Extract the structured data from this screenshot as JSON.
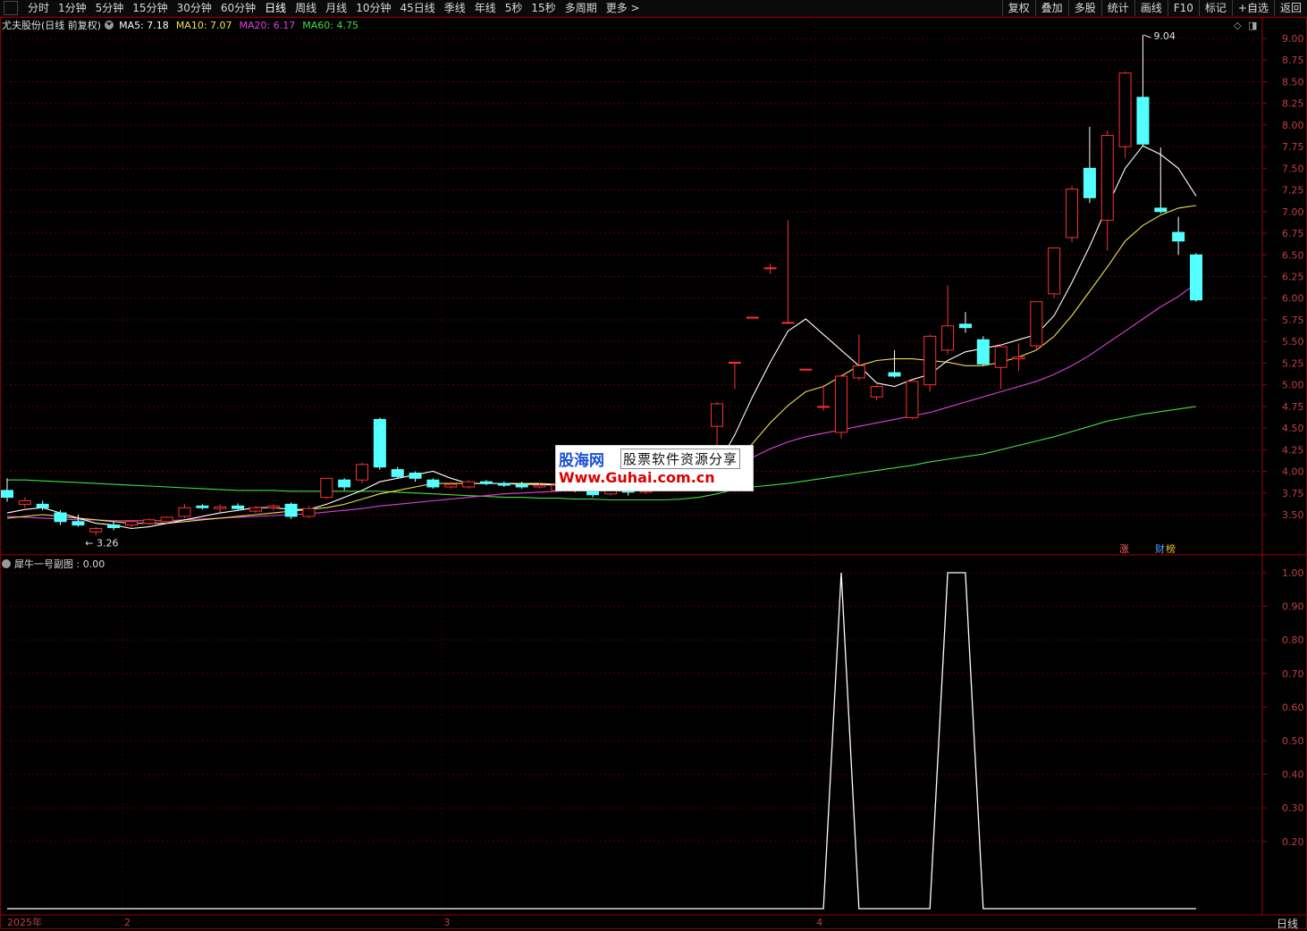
{
  "toolbar": {
    "tabs": [
      "分时",
      "1分钟",
      "5分钟",
      "15分钟",
      "30分钟",
      "60分钟",
      "日线",
      "周线",
      "月线",
      "10分钟",
      "45日线",
      "季线",
      "年线",
      "5秒",
      "15秒",
      "多周期",
      "更多 >"
    ],
    "active_tab": "日线",
    "right_buttons": [
      "复权",
      "叠加",
      "多股",
      "统计",
      "画线",
      "F10",
      "标记",
      "+自选",
      "返回"
    ]
  },
  "info": {
    "stock": "尤夫股份(日线 前复权)",
    "ma5": "MA5: 7.18",
    "ma10": "MA10: 7.07",
    "ma20": "MA20: 6.17",
    "ma60": "MA60: 4.75",
    "colors": {
      "ma5": "#ffffff",
      "ma10": "#f0e050",
      "ma20": "#e040e0",
      "ma60": "#40e040"
    }
  },
  "price_axis": [
    "9.00",
    "8.75",
    "8.50",
    "8.25",
    "8.00",
    "7.75",
    "7.50",
    "7.25",
    "7.00",
    "6.75",
    "6.50",
    "6.25",
    "6.00",
    "5.75",
    "5.50",
    "5.25",
    "5.00",
    "4.75",
    "4.50",
    "4.25",
    "4.00",
    "3.75",
    "3.50"
  ],
  "price_range": [
    3.2,
    9.1
  ],
  "annotations": {
    "high": "9.04",
    "low": "3.26"
  },
  "candles": [
    {
      "o": 3.78,
      "h": 3.92,
      "l": 3.65,
      "c": 3.7
    },
    {
      "o": 3.62,
      "h": 3.7,
      "l": 3.58,
      "c": 3.66
    },
    {
      "o": 3.62,
      "h": 3.66,
      "l": 3.55,
      "c": 3.58
    },
    {
      "o": 3.52,
      "h": 3.55,
      "l": 3.38,
      "c": 3.42
    },
    {
      "o": 3.42,
      "h": 3.5,
      "l": 3.36,
      "c": 3.38
    },
    {
      "o": 3.3,
      "h": 3.36,
      "l": 3.26,
      "c": 3.34
    },
    {
      "o": 3.38,
      "h": 3.42,
      "l": 3.32,
      "c": 3.35
    },
    {
      "o": 3.38,
      "h": 3.44,
      "l": 3.35,
      "c": 3.42
    },
    {
      "o": 3.4,
      "h": 3.46,
      "l": 3.38,
      "c": 3.44
    },
    {
      "o": 3.42,
      "h": 3.48,
      "l": 3.4,
      "c": 3.47
    },
    {
      "o": 3.48,
      "h": 3.62,
      "l": 3.46,
      "c": 3.58
    },
    {
      "o": 3.6,
      "h": 3.62,
      "l": 3.56,
      "c": 3.58
    },
    {
      "o": 3.57,
      "h": 3.62,
      "l": 3.53,
      "c": 3.59
    },
    {
      "o": 3.6,
      "h": 3.63,
      "l": 3.56,
      "c": 3.57
    },
    {
      "o": 3.54,
      "h": 3.6,
      "l": 3.52,
      "c": 3.58
    },
    {
      "o": 3.58,
      "h": 3.62,
      "l": 3.55,
      "c": 3.6
    },
    {
      "o": 3.62,
      "h": 3.64,
      "l": 3.45,
      "c": 3.48
    },
    {
      "o": 3.48,
      "h": 3.6,
      "l": 3.46,
      "c": 3.57
    },
    {
      "o": 3.7,
      "h": 3.92,
      "l": 3.68,
      "c": 3.92
    },
    {
      "o": 3.9,
      "h": 3.92,
      "l": 3.78,
      "c": 3.82
    },
    {
      "o": 3.9,
      "h": 4.1,
      "l": 3.86,
      "c": 4.08
    },
    {
      "o": 4.6,
      "h": 4.62,
      "l": 4.02,
      "c": 4.05
    },
    {
      "o": 4.02,
      "h": 4.05,
      "l": 3.92,
      "c": 3.94
    },
    {
      "o": 3.98,
      "h": 4.0,
      "l": 3.88,
      "c": 3.92
    },
    {
      "o": 3.9,
      "h": 3.92,
      "l": 3.8,
      "c": 3.82
    },
    {
      "o": 3.82,
      "h": 3.88,
      "l": 3.8,
      "c": 3.85
    },
    {
      "o": 3.82,
      "h": 3.9,
      "l": 3.8,
      "c": 3.88
    },
    {
      "o": 3.88,
      "h": 3.9,
      "l": 3.84,
      "c": 3.86
    },
    {
      "o": 3.86,
      "h": 3.88,
      "l": 3.82,
      "c": 3.84
    },
    {
      "o": 3.85,
      "h": 3.88,
      "l": 3.8,
      "c": 3.82
    },
    {
      "o": 3.82,
      "h": 3.86,
      "l": 3.8,
      "c": 3.84
    },
    {
      "o": 3.78,
      "h": 3.86,
      "l": 3.76,
      "c": 3.84
    },
    {
      "o": 3.8,
      "h": 3.84,
      "l": 3.76,
      "c": 3.78
    },
    {
      "o": 3.78,
      "h": 3.82,
      "l": 3.7,
      "c": 3.73
    },
    {
      "o": 3.74,
      "h": 3.82,
      "l": 3.72,
      "c": 3.8
    },
    {
      "o": 3.8,
      "h": 3.84,
      "l": 3.72,
      "c": 3.76
    },
    {
      "o": 3.76,
      "h": 3.84,
      "l": 3.74,
      "c": 3.82
    },
    {
      "o": 3.84,
      "h": 3.9,
      "l": 3.82,
      "c": 3.88
    },
    {
      "o": 3.9,
      "h": 3.96,
      "l": 3.88,
      "c": 3.94
    },
    {
      "o": 3.92,
      "h": 4.0,
      "l": 3.9,
      "c": 3.98
    },
    {
      "o": 4.52,
      "h": 4.8,
      "l": 4.28,
      "c": 4.78
    },
    {
      "o": 5.26,
      "h": 5.26,
      "l": 4.95,
      "c": 5.26
    },
    {
      "o": 5.78,
      "h": 5.78,
      "l": 5.78,
      "c": 5.78
    },
    {
      "o": 6.35,
      "h": 6.4,
      "l": 6.28,
      "c": 6.35
    },
    {
      "o": 5.72,
      "h": 6.9,
      "l": 5.7,
      "c": 5.72
    },
    {
      "o": 5.18,
      "h": 5.18,
      "l": 5.18,
      "c": 5.18
    },
    {
      "o": 4.75,
      "h": 5.0,
      "l": 4.7,
      "c": 4.75
    },
    {
      "o": 4.45,
      "h": 5.12,
      "l": 4.38,
      "c": 5.1
    },
    {
      "o": 5.08,
      "h": 5.58,
      "l": 5.05,
      "c": 5.22
    },
    {
      "o": 4.86,
      "h": 5.0,
      "l": 4.82,
      "c": 4.98
    },
    {
      "o": 5.14,
      "h": 5.4,
      "l": 5.08,
      "c": 5.1
    },
    {
      "o": 4.62,
      "h": 5.05,
      "l": 4.6,
      "c": 5.04
    },
    {
      "o": 5.0,
      "h": 5.58,
      "l": 4.92,
      "c": 5.56
    },
    {
      "o": 5.4,
      "h": 6.15,
      "l": 5.35,
      "c": 5.68
    },
    {
      "o": 5.7,
      "h": 5.84,
      "l": 5.6,
      "c": 5.66
    },
    {
      "o": 5.52,
      "h": 5.56,
      "l": 5.22,
      "c": 5.24
    },
    {
      "o": 5.2,
      "h": 5.46,
      "l": 4.95,
      "c": 5.44
    },
    {
      "o": 5.3,
      "h": 5.48,
      "l": 5.16,
      "c": 5.32
    },
    {
      "o": 5.45,
      "h": 5.96,
      "l": 5.4,
      "c": 5.96
    },
    {
      "o": 6.05,
      "h": 6.58,
      "l": 6.0,
      "c": 6.58
    },
    {
      "o": 6.7,
      "h": 7.3,
      "l": 6.65,
      "c": 7.26
    },
    {
      "o": 7.5,
      "h": 7.98,
      "l": 7.1,
      "c": 7.16
    },
    {
      "o": 6.9,
      "h": 7.94,
      "l": 6.55,
      "c": 7.88
    },
    {
      "o": 7.75,
      "h": 8.62,
      "l": 7.62,
      "c": 8.6
    },
    {
      "o": 8.32,
      "h": 9.04,
      "l": 7.75,
      "c": 7.78
    },
    {
      "o": 7.04,
      "h": 7.74,
      "l": 6.98,
      "c": 7.0
    },
    {
      "o": 6.76,
      "h": 6.94,
      "l": 6.5,
      "c": 6.66
    },
    {
      "o": 6.5,
      "h": 6.52,
      "l": 5.96,
      "c": 5.98
    }
  ],
  "ma5": [
    3.52,
    3.56,
    3.58,
    3.52,
    3.46,
    3.4,
    3.38,
    3.34,
    3.36,
    3.4,
    3.44,
    3.48,
    3.52,
    3.55,
    3.58,
    3.58,
    3.56,
    3.56,
    3.62,
    3.7,
    3.78,
    3.88,
    3.92,
    3.96,
    4.0,
    3.92,
    3.86,
    3.86,
    3.86,
    3.85,
    3.85,
    3.84,
    3.82,
    3.8,
    3.78,
    3.78,
    3.78,
    3.8,
    3.84,
    3.88,
    4.06,
    4.42,
    4.86,
    5.26,
    5.62,
    5.76,
    5.58,
    5.4,
    5.22,
    5.02,
    4.98,
    5.06,
    5.12,
    5.28,
    5.38,
    5.42,
    5.46,
    5.52,
    5.58,
    5.8,
    6.18,
    6.6,
    7.06,
    7.5,
    7.76,
    7.66,
    7.5,
    7.18
  ],
  "ma10": [
    3.46,
    3.48,
    3.5,
    3.48,
    3.46,
    3.44,
    3.42,
    3.4,
    3.4,
    3.4,
    3.42,
    3.44,
    3.46,
    3.48,
    3.5,
    3.52,
    3.54,
    3.56,
    3.58,
    3.62,
    3.68,
    3.74,
    3.78,
    3.82,
    3.86,
    3.86,
    3.86,
    3.86,
    3.86,
    3.86,
    3.86,
    3.85,
    3.84,
    3.83,
    3.82,
    3.81,
    3.8,
    3.8,
    3.8,
    3.82,
    3.92,
    4.1,
    4.32,
    4.56,
    4.76,
    4.92,
    4.98,
    5.1,
    5.22,
    5.28,
    5.3,
    5.3,
    5.28,
    5.26,
    5.22,
    5.22,
    5.26,
    5.32,
    5.4,
    5.56,
    5.8,
    6.08,
    6.36,
    6.66,
    6.84,
    6.96,
    7.04,
    7.07
  ],
  "ma20": [
    3.48,
    3.47,
    3.46,
    3.45,
    3.44,
    3.44,
    3.43,
    3.43,
    3.43,
    3.43,
    3.44,
    3.45,
    3.46,
    3.47,
    3.48,
    3.49,
    3.5,
    3.51,
    3.53,
    3.55,
    3.57,
    3.6,
    3.62,
    3.64,
    3.66,
    3.68,
    3.7,
    3.72,
    3.74,
    3.75,
    3.76,
    3.77,
    3.78,
    3.79,
    3.8,
    3.81,
    3.82,
    3.84,
    3.86,
    3.88,
    3.96,
    4.06,
    4.16,
    4.26,
    4.34,
    4.4,
    4.44,
    4.48,
    4.52,
    4.56,
    4.6,
    4.64,
    4.68,
    4.74,
    4.8,
    4.86,
    4.92,
    4.98,
    5.04,
    5.12,
    5.22,
    5.34,
    5.48,
    5.62,
    5.76,
    5.9,
    6.02,
    6.17
  ],
  "ma60": [
    3.9,
    3.9,
    3.89,
    3.88,
    3.87,
    3.86,
    3.85,
    3.84,
    3.83,
    3.82,
    3.81,
    3.8,
    3.79,
    3.78,
    3.78,
    3.78,
    3.77,
    3.77,
    3.77,
    3.77,
    3.77,
    3.77,
    3.76,
    3.75,
    3.74,
    3.73,
    3.72,
    3.71,
    3.7,
    3.7,
    3.69,
    3.69,
    3.68,
    3.68,
    3.67,
    3.67,
    3.67,
    3.67,
    3.68,
    3.7,
    3.74,
    3.79,
    3.82,
    3.84,
    3.86,
    3.89,
    3.92,
    3.95,
    3.98,
    4.01,
    4.04,
    4.07,
    4.11,
    4.14,
    4.17,
    4.2,
    4.25,
    4.3,
    4.35,
    4.4,
    4.46,
    4.52,
    4.58,
    4.62,
    4.66,
    4.69,
    4.72,
    4.75
  ],
  "sub": {
    "title": "犀牛一号副图 : 0.00",
    "axis": [
      "1.00",
      "0.90",
      "0.80",
      "0.70",
      "0.60",
      "0.50",
      "0.40",
      "0.30",
      "0.20"
    ],
    "range": [
      0,
      1.0
    ],
    "values": [
      0,
      0,
      0,
      0,
      0,
      0,
      0,
      0,
      0,
      0,
      0,
      0,
      0,
      0,
      0,
      0,
      0,
      0,
      0,
      0,
      0,
      0,
      0,
      0,
      0,
      0,
      0,
      0,
      0,
      0,
      0,
      0,
      0,
      0,
      0,
      0,
      0,
      0,
      0,
      0,
      0,
      0,
      0,
      0,
      0,
      0,
      0,
      1,
      0,
      0,
      0,
      0,
      0,
      1,
      1,
      0,
      0,
      0,
      0,
      0,
      0,
      0,
      0,
      0,
      0,
      0,
      0,
      0
    ]
  },
  "dates": [
    {
      "label": "2025年",
      "i": 0
    },
    {
      "label": "2",
      "i": 7
    },
    {
      "label": "3",
      "i": 25
    },
    {
      "label": "4",
      "i": 46
    }
  ],
  "period_label": "日线",
  "badges": {
    "zhang": "涨",
    "cai": "财",
    "bang": "榜"
  },
  "watermark": {
    "line1": "股海网",
    "line2": "股票软件资源分享",
    "line3": "Www.Guhai.com.cn"
  }
}
